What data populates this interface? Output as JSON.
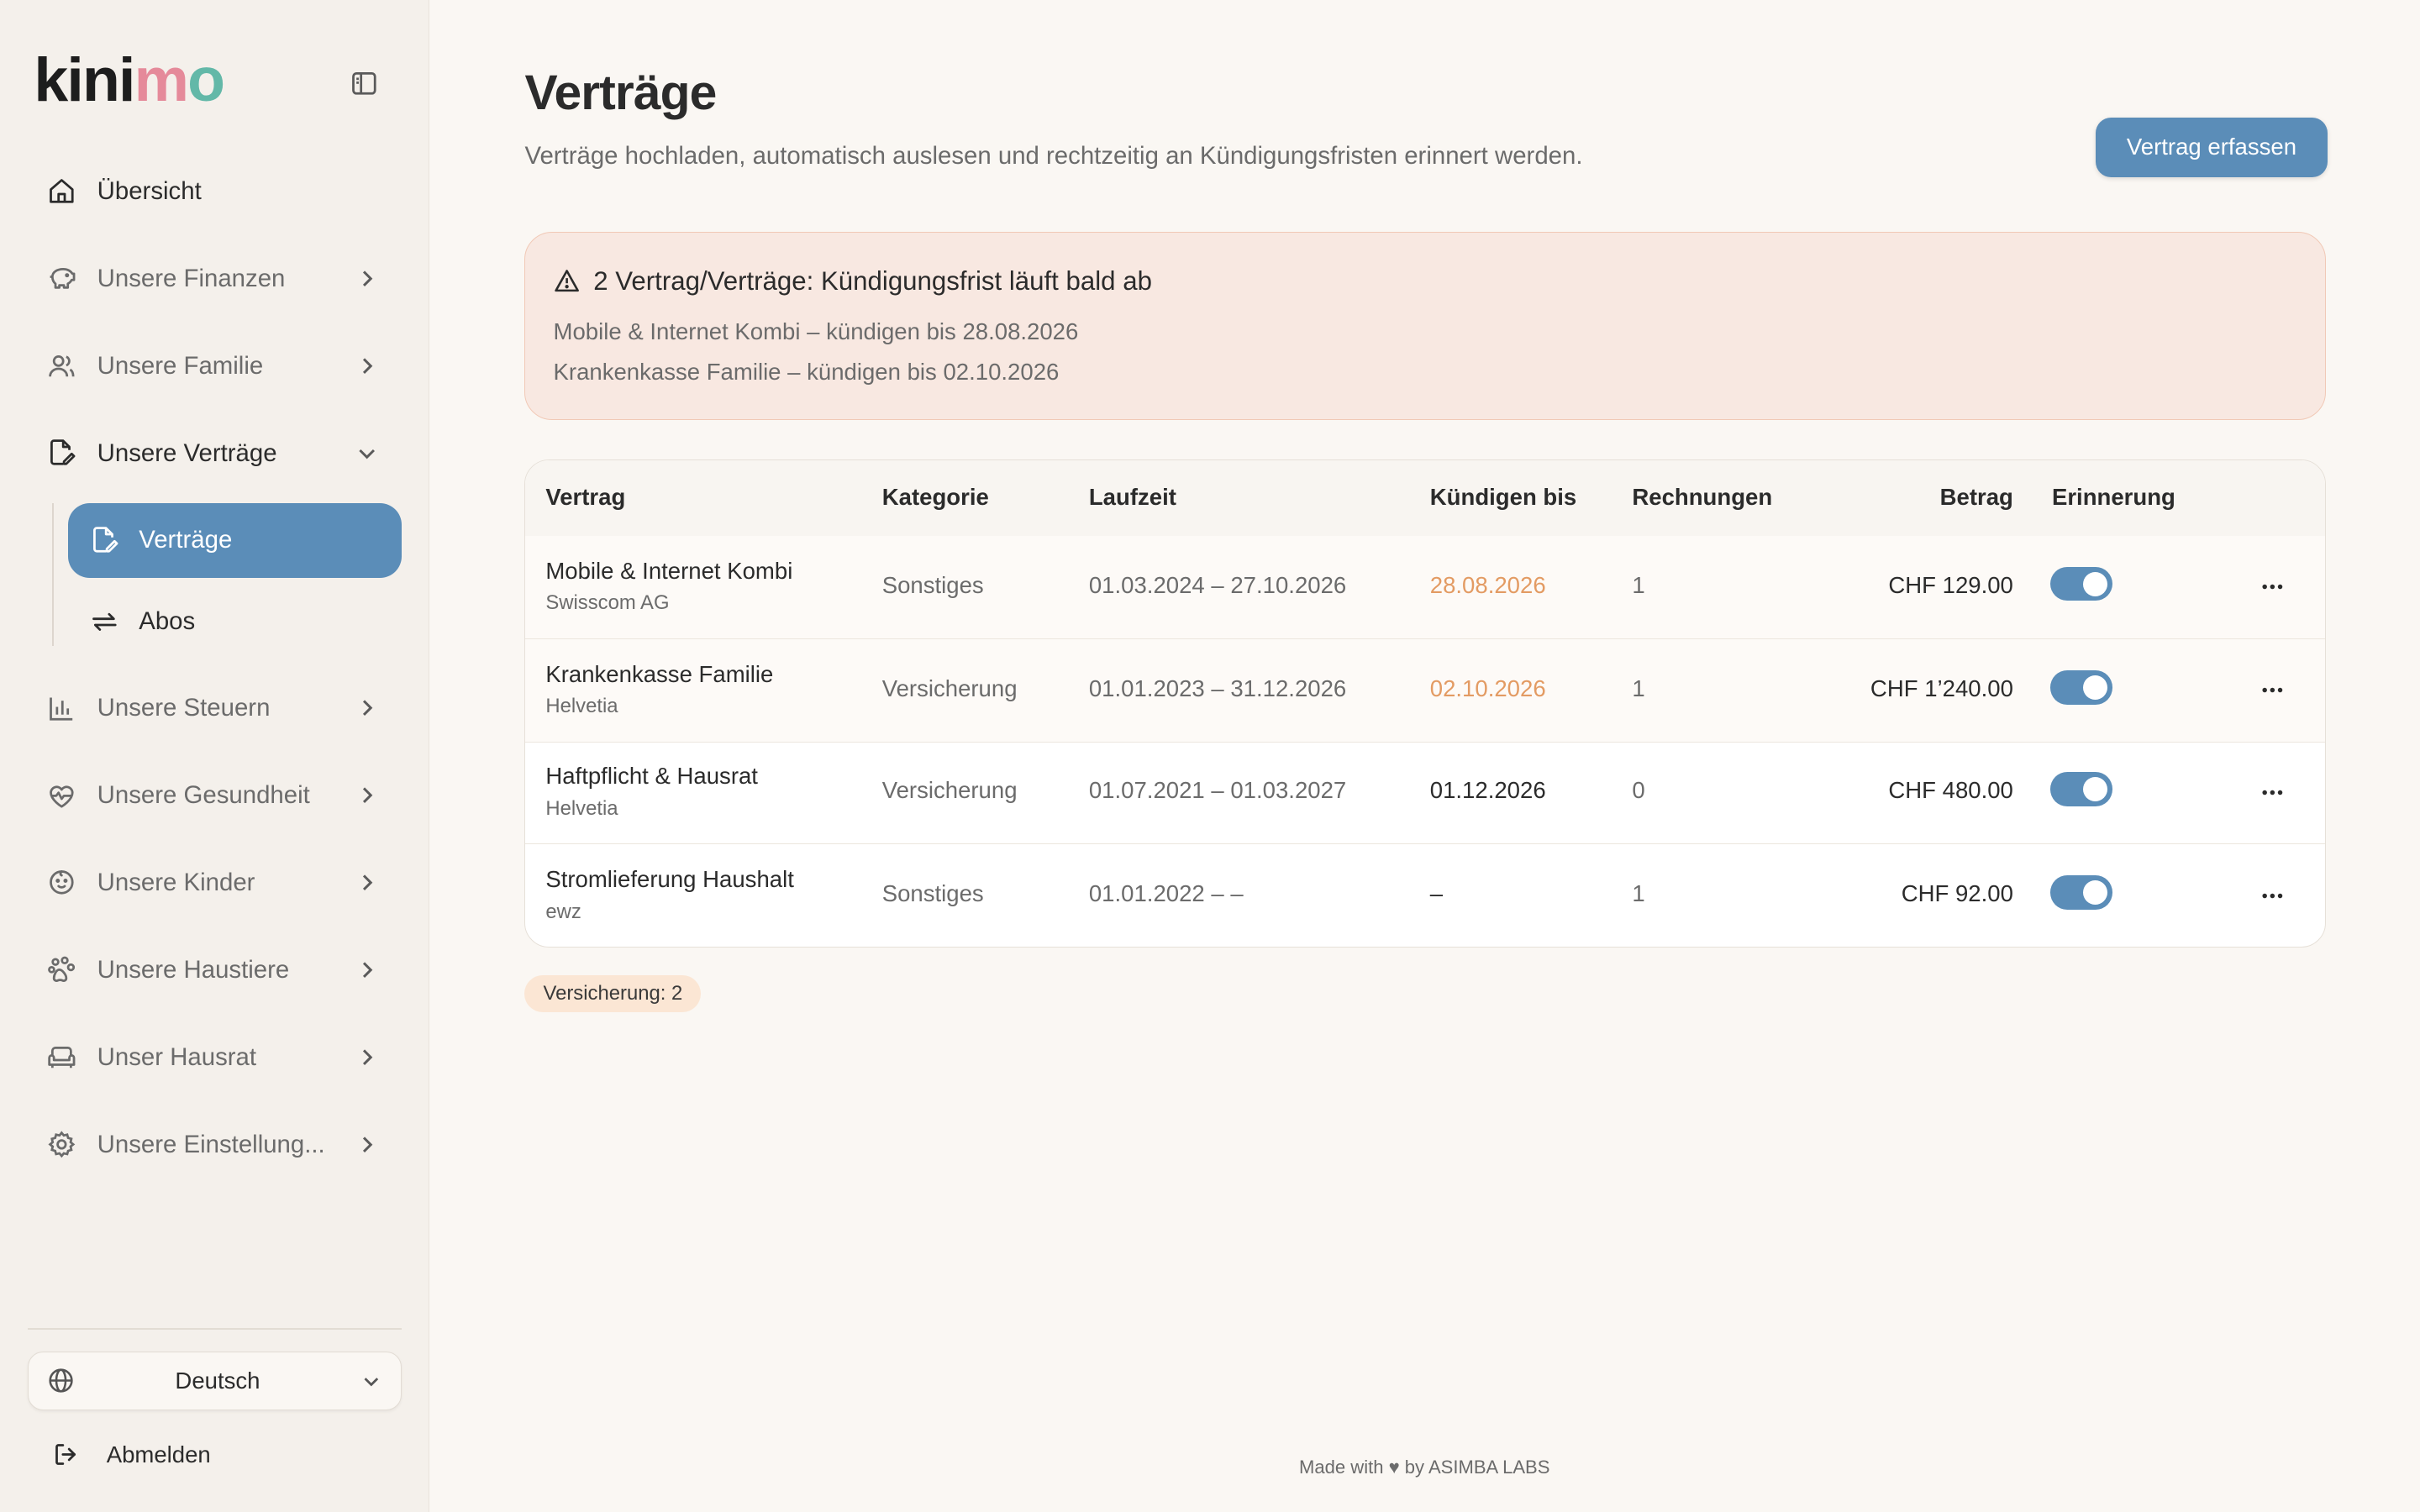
{
  "brand": {
    "logo_k": "kini",
    "logo_m": "m",
    "logo_o": "o"
  },
  "sidebar": {
    "items": [
      {
        "label": "Übersicht",
        "icon": "home-icon"
      },
      {
        "label": "Unsere Finanzen",
        "icon": "piggy-bank-icon"
      },
      {
        "label": "Unsere Familie",
        "icon": "users-icon"
      },
      {
        "label": "Unsere Verträge",
        "icon": "file-edit-icon"
      },
      {
        "label": "Unsere Steuern",
        "icon": "bar-chart-icon"
      },
      {
        "label": "Unsere Gesundheit",
        "icon": "heart-pulse-icon"
      },
      {
        "label": "Unsere Kinder",
        "icon": "baby-icon"
      },
      {
        "label": "Unsere Haustiere",
        "icon": "paw-icon"
      },
      {
        "label": "Unser Hausrat",
        "icon": "sofa-icon"
      },
      {
        "label": "Unsere Einstellung...",
        "icon": "gear-icon"
      }
    ],
    "sub_items": [
      {
        "label": "Verträge",
        "icon": "file-edit-icon"
      },
      {
        "label": "Abos",
        "icon": "repeat-icon"
      }
    ],
    "language": "Deutsch",
    "logout": "Abmelden"
  },
  "page": {
    "title": "Verträge",
    "subtitle": "Verträge hochladen, automatisch auslesen und rechtzeitig an Kündigungsfristen erinnert werden.",
    "add_button": "Vertrag erfassen"
  },
  "alert": {
    "title": "2 Vertrag/Verträge: Kündigungsfrist läuft bald ab",
    "lines": [
      "Mobile & Internet Kombi – kündigen bis 28.08.2026",
      "Krankenkasse Familie – kündigen bis 02.10.2026"
    ]
  },
  "table": {
    "headers": [
      "Vertrag",
      "Kategorie",
      "Laufzeit",
      "Kündigen bis",
      "Rechnungen",
      "Betrag",
      "Erinnerung"
    ],
    "rows": [
      {
        "name": "Mobile & Internet Kombi",
        "provider": "Swisscom AG",
        "category": "Sonstiges",
        "term": "01.03.2024 – 27.10.2026",
        "cancel_by": "28.08.2026",
        "invoices": "1",
        "amount": "CHF 129.00",
        "reminder": true,
        "cancel_warning": true
      },
      {
        "name": "Krankenkasse Familie",
        "provider": "Helvetia",
        "category": "Versicherung",
        "term": "01.01.2023 – 31.12.2026",
        "cancel_by": "02.10.2026",
        "invoices": "1",
        "amount": "CHF 1’240.00",
        "reminder": true,
        "cancel_warning": true
      },
      {
        "name": "Haftpflicht & Hausrat",
        "provider": "Helvetia",
        "category": "Versicherung",
        "term": "01.07.2021 – 01.03.2027",
        "cancel_by": "01.12.2026",
        "invoices": "0",
        "amount": "CHF 480.00",
        "reminder": true,
        "cancel_warning": false
      },
      {
        "name": "Stromlieferung Haushalt",
        "provider": "ewz",
        "category": "Sonstiges",
        "term": "01.01.2022 – –",
        "cancel_by": "–",
        "invoices": "1",
        "amount": "CHF 92.00",
        "reminder": true,
        "cancel_warning": false
      }
    ]
  },
  "badge": "Versicherung: 2",
  "footer": "Made with ♥ by ASIMBA LABS",
  "colors": {
    "accent": "#5b8db8",
    "warning": "#e39b63",
    "alert_bg": "#f8e8e1",
    "background": "#faf7f3"
  }
}
